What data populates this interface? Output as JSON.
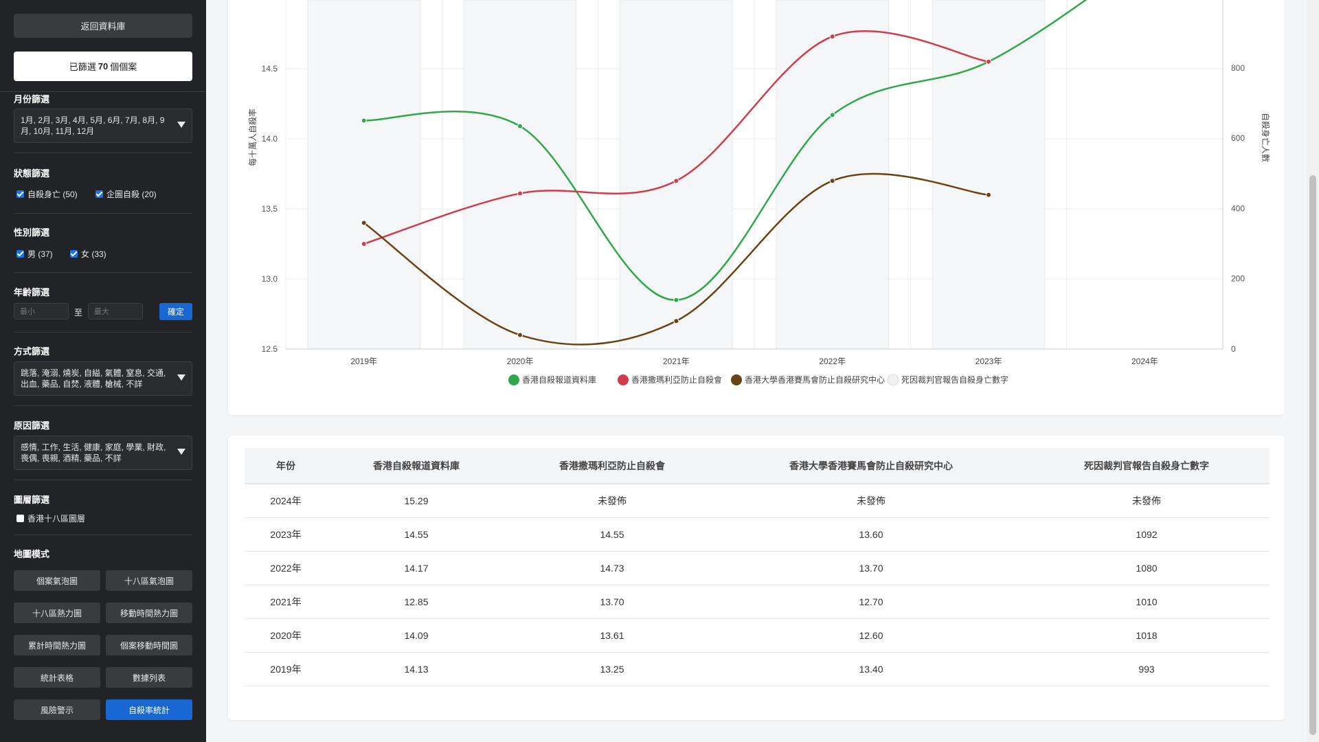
{
  "sidebar": {
    "back_label": "返回資料庫",
    "filtered": {
      "prefix": "已篩選",
      "count": "70",
      "suffix": "個個案"
    },
    "month_filter": {
      "title": "月份篩選",
      "value": "1月, 2月, 3月, 4月, 5月, 6月, 7月, 8月, 9月, 10月, 11月, 12月"
    },
    "status_filter": {
      "title": "狀態篩選",
      "options": [
        {
          "label": "自殺身亡 (50)",
          "checked": true
        },
        {
          "label": "企圖自殺 (20)",
          "checked": true
        }
      ]
    },
    "gender_filter": {
      "title": "性別篩選",
      "options": [
        {
          "label": "男 (37)",
          "checked": true
        },
        {
          "label": "女 (33)",
          "checked": true
        }
      ]
    },
    "age_filter": {
      "title": "年齡篩選",
      "min_placeholder": "最小",
      "max_placeholder": "最大",
      "to_label": "至",
      "confirm_label": "確定"
    },
    "method_filter": {
      "title": "方式篩選",
      "value": "跳落, 淹溺, 燒炭, 自縊, 氣體, 窒息, 交通, 出血, 藥品, 自焚, 液體, 槍械, 不詳"
    },
    "reason_filter": {
      "title": "原因篩選",
      "value": "感情, 工作, 生活, 健康, 家庭, 學業, 財政, 喪偶, 喪親, 酒精, 藥品, 不詳"
    },
    "layer_filter": {
      "title": "圖層篩選",
      "options": [
        {
          "label": "香港十八區圖層",
          "checked": false
        }
      ]
    },
    "map_mode": {
      "title": "地圖模式",
      "buttons": [
        {
          "label": "個案氣泡圖",
          "active": false
        },
        {
          "label": "十八區氣泡圖",
          "active": false
        },
        {
          "label": "十八區熱力圖",
          "active": false
        },
        {
          "label": "移動時間熱力圖",
          "active": false
        },
        {
          "label": "累計時間熱力圖",
          "active": false
        },
        {
          "label": "個案移動時間圖",
          "active": false
        },
        {
          "label": "統計表格",
          "active": false
        },
        {
          "label": "數據列表",
          "active": false
        },
        {
          "label": "風險警示",
          "active": false
        },
        {
          "label": "自殺率統計",
          "active": true
        }
      ]
    }
  },
  "colors": {
    "green": "#2ea84a",
    "red": "#d23c4a",
    "brown": "#6b4312",
    "grey": "#e6e6e6",
    "accent": "#1967d2"
  },
  "chart_data": {
    "type": "line",
    "categories": [
      "2019年",
      "2020年",
      "2021年",
      "2022年",
      "2023年",
      "2024年"
    ],
    "ylabel": "每十萬人自殺率",
    "y2label": "自殺身亡人數",
    "ylim_visible": [
      12.5,
      14.5
    ],
    "y_ticks": [
      "12.5",
      "13.0",
      "13.5",
      "14.0",
      "14.5"
    ],
    "y2_ticks": [
      "0",
      "200",
      "400",
      "600",
      "800"
    ],
    "legend_position": "bottom",
    "series": [
      {
        "name": "香港自殺報道資料庫",
        "color": "#2ea84a",
        "axis": "left",
        "values": [
          14.13,
          14.09,
          12.85,
          14.17,
          14.55,
          15.29
        ]
      },
      {
        "name": "香港撒瑪利亞防止自殺會",
        "color": "#d23c4a",
        "axis": "left",
        "values": [
          13.25,
          13.61,
          13.7,
          14.73,
          14.55,
          null
        ]
      },
      {
        "name": "香港大學香港賽馬會防止自殺研究中心",
        "color": "#6b4312",
        "axis": "left",
        "values": [
          13.4,
          12.6,
          12.7,
          13.7,
          13.6,
          null
        ]
      },
      {
        "name": "死因裁判官報告自殺身亡數字",
        "color": "#e6e6e6",
        "axis": "right",
        "type": "bar",
        "values": [
          993,
          1018,
          1010,
          1080,
          1092,
          null
        ]
      }
    ]
  },
  "table": {
    "headers": [
      "年份",
      "香港自殺報道資料庫",
      "香港撒瑪利亞防止自殺會",
      "香港大學香港賽馬會防止自殺研究中心",
      "死因裁判官報告自殺身亡數字"
    ],
    "rows": [
      [
        "2024年",
        "15.29",
        "未發佈",
        "未發佈",
        "未發佈"
      ],
      [
        "2023年",
        "14.55",
        "14.55",
        "13.60",
        "1092"
      ],
      [
        "2022年",
        "14.17",
        "14.73",
        "13.70",
        "1080"
      ],
      [
        "2021年",
        "12.85",
        "13.70",
        "12.70",
        "1010"
      ],
      [
        "2020年",
        "14.09",
        "13.61",
        "12.60",
        "1018"
      ],
      [
        "2019年",
        "14.13",
        "13.25",
        "13.40",
        "993"
      ]
    ]
  }
}
